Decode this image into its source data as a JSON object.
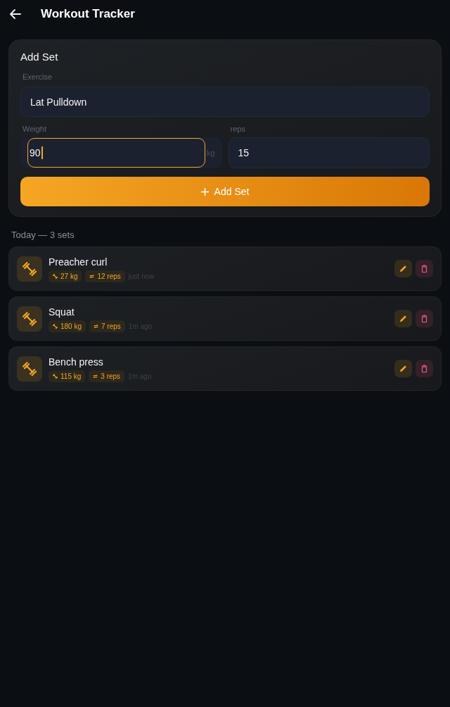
{
  "header": {
    "title": "Workout Tracker"
  },
  "form": {
    "title": "Add Set",
    "exercise": {
      "label": "Exercise",
      "value": "Lat Pulldown",
      "focused": false
    },
    "weight": {
      "label": "Weight",
      "value": "90",
      "unit": "kg",
      "focused": true
    },
    "reps": {
      "label": "reps",
      "value": "15",
      "focused": false
    },
    "submit": {
      "label": "Add Set"
    }
  },
  "log": {
    "heading": "Today — 3 sets",
    "sets": [
      {
        "name": "Preacher curl",
        "weight": "27 kg",
        "reps": "12 reps",
        "time": "just now"
      },
      {
        "name": "Squat",
        "weight": "180 kg",
        "reps": "7 reps",
        "time": "1m ago"
      },
      {
        "name": "Bench press",
        "weight": "115 kg",
        "reps": "3 reps",
        "time": "1m ago"
      }
    ]
  }
}
